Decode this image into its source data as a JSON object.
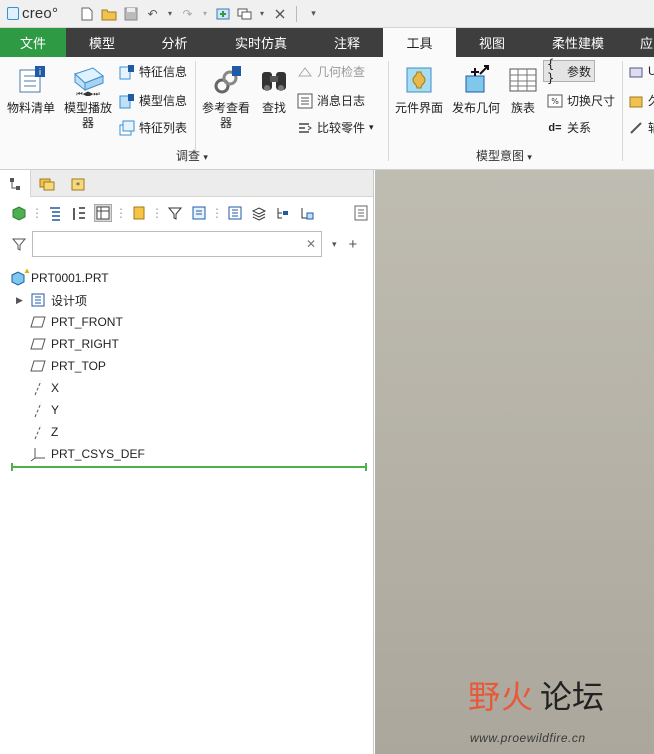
{
  "app": {
    "logo_text": "creo°"
  },
  "qat": {
    "icons": [
      "new-icon",
      "open-icon",
      "save-icon",
      "undo-icon",
      "redo-icon",
      "regenerate-icon",
      "windows-icon",
      "close-icon",
      "customize-icon"
    ]
  },
  "tabs": [
    "文件",
    "模型",
    "分析",
    "实时仿真",
    "注释",
    "工具",
    "视图",
    "柔性建模",
    "应"
  ],
  "active_tab": "工具",
  "ribbon": {
    "investigate": {
      "bom": "物料清单",
      "model_player": "模型播放器",
      "feature_info": "特征信息",
      "model_info": "模型信息",
      "feature_list": "特征列表",
      "reference_viewer": "参考查看器",
      "find": "查找",
      "geometry_check": "几何检查",
      "message_log": "消息日志",
      "compare_part": "比较零件",
      "group_label": "调查"
    },
    "model_intent": {
      "component_interface": "元件界面",
      "publish_geometry": "发布几何",
      "family_table": "族表",
      "parameters": "参数",
      "switch_dimensions": "切换尺寸",
      "relations": "关系",
      "group_label": "模型意图"
    },
    "partial": {
      "item1": "U",
      "item2": "久",
      "item3": "辅"
    }
  },
  "model_tree": {
    "filter_placeholder": "",
    "root": "PRT0001.PRT",
    "items": [
      "设计项",
      "PRT_FRONT",
      "PRT_RIGHT",
      "PRT_TOP",
      "X",
      "Y",
      "Z",
      "PRT_CSYS_DEF"
    ]
  },
  "watermark": {
    "brand_a": "野火",
    "brand_b": "论坛",
    "url": "www.proewildfire.cn"
  },
  "colors": {
    "file_tab": "#2f9a44",
    "tab_bar": "#3e3e3e",
    "accent": "#3a8fd0",
    "insert_line": "#4cb14c"
  }
}
